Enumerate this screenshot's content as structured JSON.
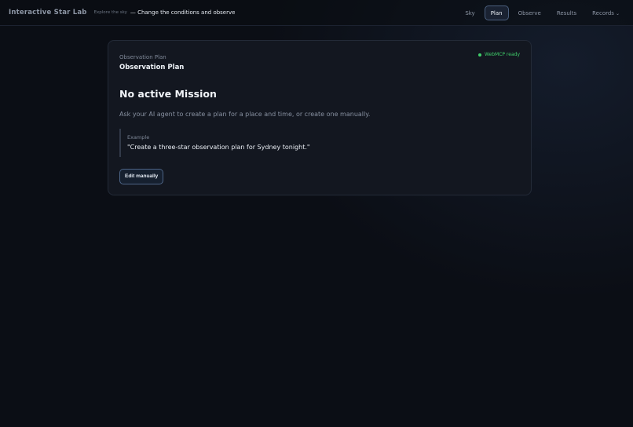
{
  "header": {
    "brand": "Interactive Star Lab",
    "tagline_small": "Explore the sky",
    "tagline_main": "— Change the conditions and observe"
  },
  "nav": {
    "items": [
      {
        "label": "Sky"
      },
      {
        "label": "Plan"
      },
      {
        "label": "Observe"
      },
      {
        "label": "Results"
      },
      {
        "label": "Records"
      }
    ],
    "active": "Plan",
    "records_chevron": "⌄"
  },
  "card": {
    "eyebrow": "Observation Plan",
    "title": "Observation Plan",
    "status": "WebMCP ready",
    "status_color": "#3fce6a",
    "empty_heading": "No active Mission",
    "empty_description": "Ask your AI agent to create a plan for a place and time, or create one manually.",
    "example_label": "Example",
    "example_text": "\"Create a three-star observation plan for Sydney tonight.\"",
    "edit_button": "Edit manually"
  }
}
